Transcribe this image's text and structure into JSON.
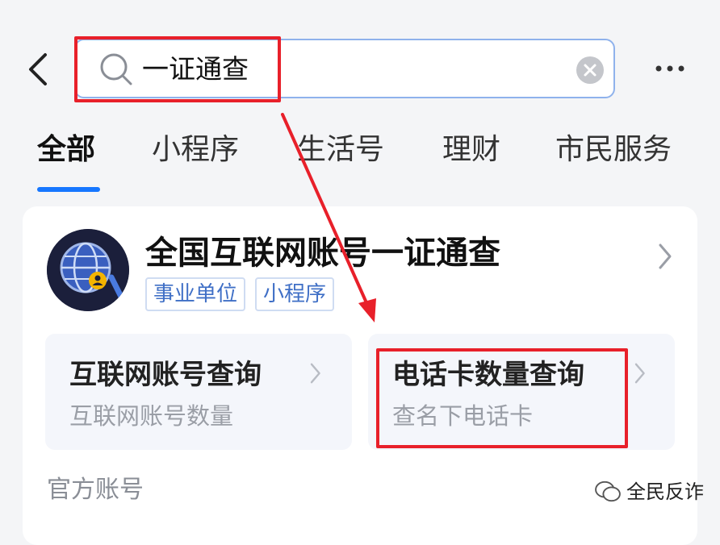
{
  "search": {
    "query": "一证通查"
  },
  "tabs": [
    {
      "label": "全部"
    },
    {
      "label": "小程序"
    },
    {
      "label": "生活号"
    },
    {
      "label": "理财"
    },
    {
      "label": "市民服务"
    }
  ],
  "result": {
    "title": "全国互联网账号一证通查",
    "tags": [
      "事业单位",
      "小程序"
    ],
    "services": [
      {
        "title": "互联网账号查询",
        "subtitle": "互联网账号数量"
      },
      {
        "title": "电话卡数量查询",
        "subtitle": "查名下电话卡"
      }
    ]
  },
  "section_label": "官方账号",
  "watermark": "全民反诈",
  "colors": {
    "accent": "#1677ff",
    "highlight": "#e8202a",
    "tag_text": "#3f6fc6"
  }
}
